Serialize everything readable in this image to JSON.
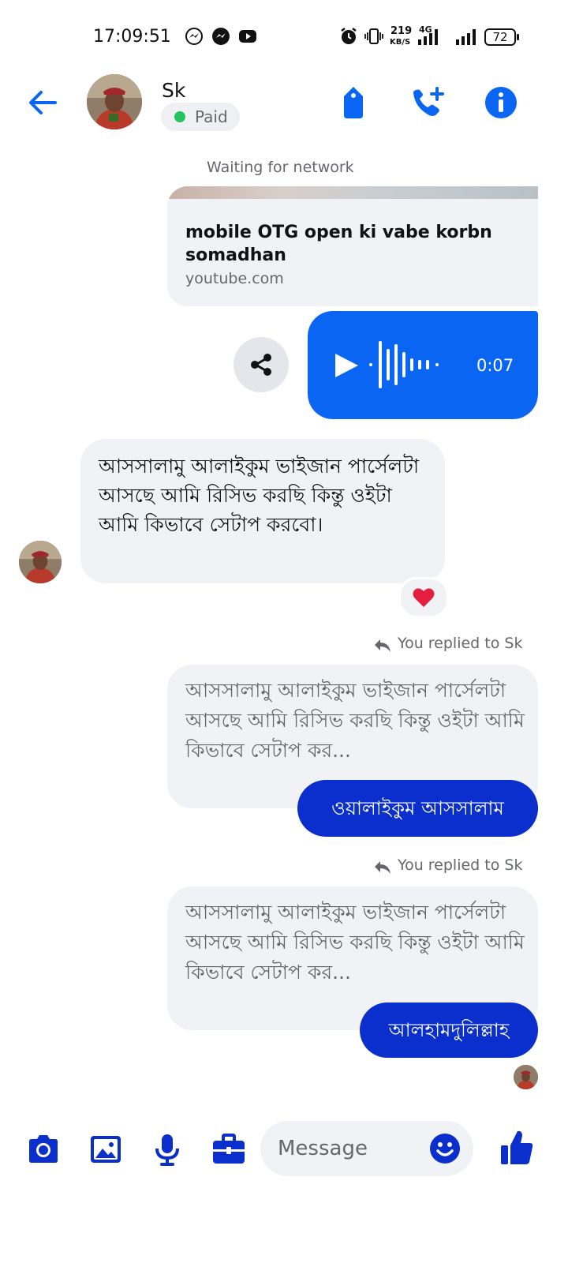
{
  "status_bar": {
    "time": "17:09:51",
    "net_speed_value": "219",
    "net_speed_unit": "KB/S",
    "network_type": "4G",
    "battery": "72"
  },
  "header": {
    "contact_name": "Sk",
    "badge_label": "Paid"
  },
  "chat": {
    "waiting_text": "Waiting for network",
    "link_preview": {
      "title": "mobile OTG open ki vabe korbn somadhan",
      "domain": "youtube.com"
    },
    "voice_message": {
      "duration": "0:07"
    },
    "received_message": {
      "text": "আসসালামু আলাইকুম ভাইজান পার্সেলটা আসছে আমি রিসিভ করছি কিন্তু ওইটা আমি কিভাবে সেটাপ করবো।",
      "reaction": "❤️"
    },
    "replies": [
      {
        "label": "You replied to Sk",
        "quoted_text": "আসসালামু আলাইকুম ভাইজান পার্সেলটা আসছে আমি রিসিভ করছি কিন্তু ওইটা আমি কিভাবে সেটাপ কর...",
        "message": "ওয়ালাইকুম আসসালাম"
      },
      {
        "label": "You replied to Sk",
        "quoted_text": "আসসালামু আলাইকুম ভাইজান পার্সেলটা আসছে আমি রিসিভ করছি কিন্তু ওইটা আমি কিভাবে সেটাপ কর...",
        "message": "আলহামদুলিল্লাহ"
      }
    ]
  },
  "composer": {
    "placeholder": "Message"
  },
  "colors": {
    "accent": "#0a66f2",
    "reply_bubble": "#0a2fcc",
    "composer_icon": "#0a2fcc",
    "online_dot": "#22c55e"
  }
}
